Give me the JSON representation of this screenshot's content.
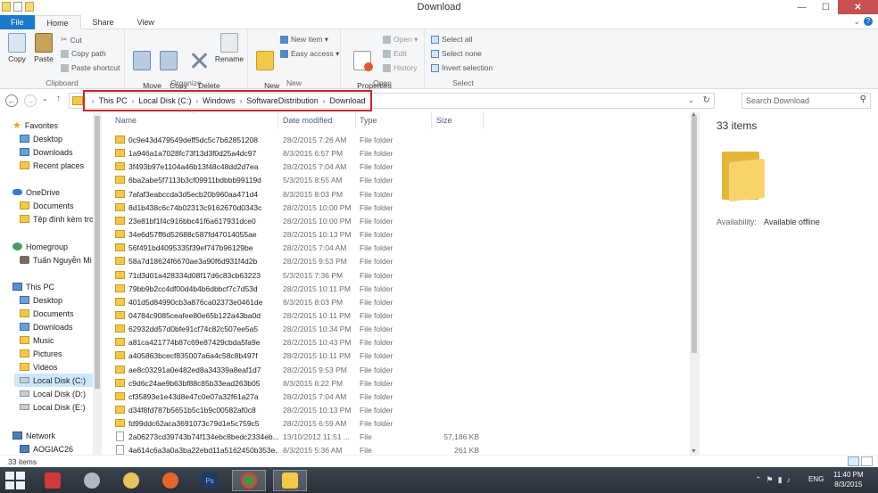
{
  "window": {
    "title": "Download",
    "minimize": "—",
    "maximize": "☐",
    "close": "✕"
  },
  "ribbon_tabs": [
    "File",
    "Home",
    "Share",
    "View"
  ],
  "ribbon": {
    "clipboard": {
      "label": "Clipboard",
      "copy": "Copy",
      "paste": "Paste",
      "cut": "Cut",
      "copy_path": "Copy path",
      "paste_shortcut": "Paste shortcut"
    },
    "organize": {
      "label": "Organize",
      "move_to": "Move\nto ▾",
      "copy_to": "Copy\nto ▾",
      "delete": "Delete\n▾",
      "rename": "Rename"
    },
    "new": {
      "label": "New",
      "new_folder": "New\nfolder",
      "new_item": "New item ▾",
      "easy_access": "Easy access ▾"
    },
    "open": {
      "label": "Open",
      "properties": "Properties\n▾",
      "open": "Open ▾",
      "edit": "Edit",
      "history": "History"
    },
    "select": {
      "label": "Select",
      "select_all": "Select all",
      "select_none": "Select none",
      "invert_selection": "Invert selection"
    }
  },
  "address": {
    "crumbs": [
      "This PC",
      "Local Disk (C:)",
      "Windows",
      "SoftwareDistribution",
      "Download"
    ],
    "search_placeholder": "Search Download"
  },
  "nav": {
    "favorites": "Favorites",
    "favorites_items": [
      "Desktop",
      "Downloads",
      "Recent places"
    ],
    "onedrive": "OneDrive",
    "onedrive_items": [
      "Documents",
      "Tệp đính kèm tro"
    ],
    "homegroup": "Homegroup",
    "homegroup_items": [
      "Tuấn Nguyễn Mi"
    ],
    "thispc": "This PC",
    "thispc_items": [
      "Desktop",
      "Documents",
      "Downloads",
      "Music",
      "Pictures",
      "Videos",
      "Local Disk (C:)",
      "Local Disk (D:)",
      "Local Disk (E:)"
    ],
    "network": "Network",
    "network_items": [
      "AOGIAC26"
    ]
  },
  "columns": {
    "name": "Name",
    "date": "Date modified",
    "type": "Type",
    "size": "Size"
  },
  "files": [
    {
      "name": "0c9e43d479549deff5dc5c7b62851208",
      "date": "28/2/2015 7:26 AM",
      "type": "File folder",
      "size": "",
      "kind": "folder"
    },
    {
      "name": "1a946a1a7028fc73f13d3f0d25a4dc97",
      "date": "8/3/2015 6:57 PM",
      "type": "File folder",
      "size": "",
      "kind": "folder"
    },
    {
      "name": "3f493b97e1104a46b13f48c48dd2d7ea",
      "date": "28/2/2015 7:04 AM",
      "type": "File folder",
      "size": "",
      "kind": "folder"
    },
    {
      "name": "6ba2abe5f7113b3cf09911bdbbb99119d",
      "date": "5/3/2015 8:55 AM",
      "type": "File folder",
      "size": "",
      "kind": "folder"
    },
    {
      "name": "7afaf3eabccda3d5ecb20b960aa471d4",
      "date": "8/3/2015 8:03 PM",
      "type": "File folder",
      "size": "",
      "kind": "folder"
    },
    {
      "name": "8d1b438c6c74b02313c9162670d0343c",
      "date": "28/2/2015 10:00 PM",
      "type": "File folder",
      "size": "",
      "kind": "folder"
    },
    {
      "name": "23e81bf1f4c916bbc41f6a617931dce0",
      "date": "28/2/2015 10:00 PM",
      "type": "File folder",
      "size": "",
      "kind": "folder"
    },
    {
      "name": "34e6d57ff6d52688c587fd47014055ae",
      "date": "28/2/2015 10:13 PM",
      "type": "File folder",
      "size": "",
      "kind": "folder"
    },
    {
      "name": "56f491bd4095335f39ef747b96129be",
      "date": "28/2/2015 7:04 AM",
      "type": "File folder",
      "size": "",
      "kind": "folder"
    },
    {
      "name": "58a7d18624f6670ae3a90f6d931f4d2b",
      "date": "28/2/2015 9:53 PM",
      "type": "File folder",
      "size": "",
      "kind": "folder"
    },
    {
      "name": "71d3d01a428334d08f17d6c83cb63223",
      "date": "5/3/2015 7:36 PM",
      "type": "File folder",
      "size": "",
      "kind": "folder"
    },
    {
      "name": "79bb9b2cc4df00d4b4b6dbbcf7c7d53d",
      "date": "28/2/2015 10:11 PM",
      "type": "File folder",
      "size": "",
      "kind": "folder"
    },
    {
      "name": "401d5d84990cb3a876ca02373e0461de",
      "date": "8/3/2015 8:03 PM",
      "type": "File folder",
      "size": "",
      "kind": "folder"
    },
    {
      "name": "04784c9085ceafee80e65b122a43ba0d",
      "date": "28/2/2015 10:11 PM",
      "type": "File folder",
      "size": "",
      "kind": "folder"
    },
    {
      "name": "62932dd57d0bfe91cf74c82c507ee5a5",
      "date": "28/2/2015 10:34 PM",
      "type": "File folder",
      "size": "",
      "kind": "folder"
    },
    {
      "name": "a81ca421774b87c69e87429cbda5fa9e",
      "date": "28/2/2015 10:43 PM",
      "type": "File folder",
      "size": "",
      "kind": "folder"
    },
    {
      "name": "a405863bcecf835007a6a4c58c8b497f",
      "date": "28/2/2015 10:11 PM",
      "type": "File folder",
      "size": "",
      "kind": "folder"
    },
    {
      "name": "ae8c03291a0e482ed8a34339a8eaf1d7",
      "date": "28/2/2015 9:53 PM",
      "type": "File folder",
      "size": "",
      "kind": "folder"
    },
    {
      "name": "c9d6c24ae9b63bf88c85b33ead263b05",
      "date": "8/3/2015 6:22 PM",
      "type": "File folder",
      "size": "",
      "kind": "folder"
    },
    {
      "name": "cf35893e1e43d8e47c0e07a32f61a27a",
      "date": "28/2/2015 7:04 AM",
      "type": "File folder",
      "size": "",
      "kind": "folder"
    },
    {
      "name": "d34f8fd787b5651b5c1b9c00582af0c8",
      "date": "28/2/2015 10:13 PM",
      "type": "File folder",
      "size": "",
      "kind": "folder"
    },
    {
      "name": "fd99ddc62aca3691073c79d1e5c759c5",
      "date": "28/2/2015 6:59 AM",
      "type": "File folder",
      "size": "",
      "kind": "folder"
    },
    {
      "name": "2a06273cd39743b74f134ebc8bedc2334eb...",
      "date": "13/10/2012 11:51 ...",
      "type": "File",
      "size": "57,186 KB",
      "kind": "file"
    },
    {
      "name": "4a614c6a3a0a3ba22ebd11a5162450b353e...",
      "date": "8/3/2015 5:36 AM",
      "type": "File",
      "size": "261 KB",
      "kind": "file"
    }
  ],
  "details": {
    "count": "33 items",
    "availability_label": "Availability:",
    "availability_value": "Available offline"
  },
  "status": {
    "items": "33 items"
  },
  "taskbar": {
    "lang": "ENG",
    "time": "11:40 PM",
    "date": "8/3/2015",
    "colors": {
      "accent": "#1979ca",
      "highlight_box": "#d2232a",
      "folder": "#f3c94b"
    }
  }
}
